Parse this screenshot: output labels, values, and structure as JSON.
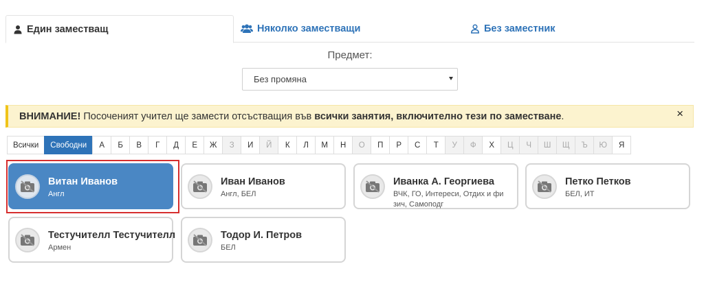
{
  "tabs": [
    {
      "label": "Един заместващ",
      "icon": "user-icon",
      "active": true
    },
    {
      "label": "Няколко заместващи",
      "icon": "users-icon",
      "active": false
    },
    {
      "label": "Без заместник",
      "icon": "user-outline-icon",
      "active": false
    }
  ],
  "subject": {
    "label": "Предмет:",
    "selected": "Без промяна"
  },
  "alert": {
    "strong": "ВНИМАНИЕ!",
    "text": " Посоченият учител ще замести отсъстващия във ",
    "bold_tail": "всички занятия, включително тези по заместване",
    "end": ".",
    "close": "×"
  },
  "letters": {
    "all": "Всички",
    "free": "Свободни",
    "items": [
      "А",
      "Б",
      "В",
      "Г",
      "Д",
      "Е",
      "Ж",
      "З",
      "И",
      "Й",
      "К",
      "Л",
      "М",
      "Н",
      "О",
      "П",
      "Р",
      "С",
      "Т",
      "У",
      "Ф",
      "Х",
      "Ц",
      "Ч",
      "Ш",
      "Щ",
      "Ъ",
      "Ю",
      "Я"
    ],
    "disabled": [
      "З",
      "Й",
      "О",
      "У",
      "Ф",
      "Ц",
      "Ч",
      "Ш",
      "Щ",
      "Ъ",
      "Ю"
    ]
  },
  "teachers": [
    {
      "name": "Витан Иванов",
      "subjects": "Англ",
      "selected": true
    },
    {
      "name": "Иван Иванов",
      "subjects": "Англ, БЕЛ",
      "selected": false
    },
    {
      "name": "Иванка А. Георгиева",
      "subjects": "ВЧК, ГО, Интереси, Отдих и фи зич, Самоподг",
      "selected": false
    },
    {
      "name": "Петко Петков",
      "subjects": "БЕЛ, ИТ",
      "selected": false
    },
    {
      "name": "Тестучителл Тестучителл",
      "subjects": "Армен",
      "selected": false
    },
    {
      "name": "Тодор И. Петров",
      "subjects": "БЕЛ",
      "selected": false
    }
  ],
  "colors": {
    "accent": "#2e73b8",
    "selected_card": "#4a87c4",
    "alert_bg": "#fcf3cf",
    "highlight": "#d62d2d"
  }
}
